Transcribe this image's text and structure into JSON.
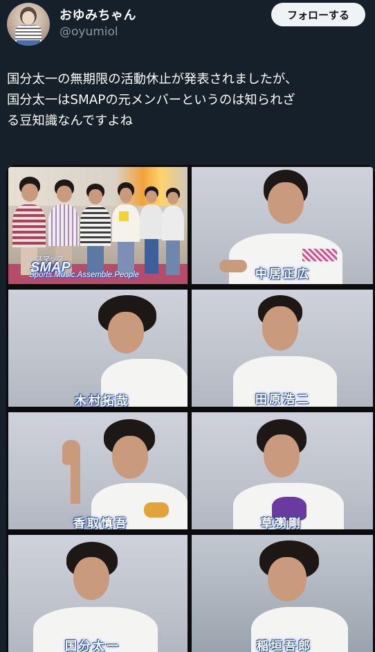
{
  "user": {
    "display_name": "おゆみちゃん",
    "handle": "@oyumiol"
  },
  "follow_button_label": "フォローする",
  "tweet": {
    "lines": [
      "国分太一の無期限の活動休止が発表されましたが、",
      "国分太一はSMAPの元メンバーというのは知られざ",
      "る豆知識なんですよね"
    ]
  },
  "media": {
    "group_logo": "SMAP",
    "group_logo_kana": "スマップ",
    "group_logo_subtitle": "Sports.Music.Assemble.People",
    "captions": {
      "p1": "中居正広",
      "p2": "木村拓哉",
      "p3": "田原浩二",
      "p4": "香取慎吾",
      "p5": "草彅剛",
      "p6": "国分太一",
      "p7": "稲垣吾郎"
    }
  }
}
